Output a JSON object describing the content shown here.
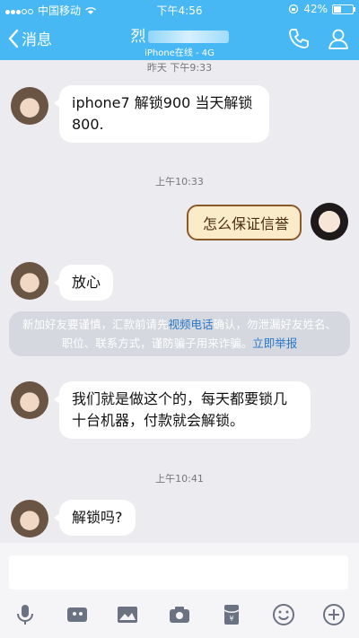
{
  "status_bar": {
    "carrier": "中国移动",
    "time": "下午4:56",
    "battery": "42%"
  },
  "nav": {
    "back_label": "消息",
    "contact_name_visible": "烈",
    "subtitle": "iPhone在线 - 4G"
  },
  "messages": [
    {
      "type": "timestamp",
      "text": "昨天 下午9:33"
    },
    {
      "type": "incoming",
      "text": "iphone7 解锁900 当天解锁800."
    },
    {
      "type": "timestamp",
      "text": "上午10:33"
    },
    {
      "type": "outgoing_sticker",
      "text": "怎么保证信誉"
    },
    {
      "type": "incoming",
      "text": "放心"
    },
    {
      "type": "notice",
      "text_before": "新加好友要谨慎，汇款前请先",
      "link1": "视频电话",
      "text_after": "确认，勿泄漏好友姓名、职位、联系方式，谨防骗子用来诈骗。",
      "link2": "立即举报"
    },
    {
      "type": "incoming",
      "text": "我们就是做这个的，每天都要锁几十台机器，付款就会解锁。"
    },
    {
      "type": "timestamp",
      "text": "上午10:41"
    },
    {
      "type": "incoming",
      "text": "解锁吗?"
    }
  ],
  "toolbar": {
    "icons": [
      "microphone-icon",
      "video-icon",
      "image-icon",
      "camera-icon",
      "red-packet-icon",
      "emoji-icon",
      "plus-icon"
    ]
  },
  "colors": {
    "nav_bg": "#48b8f4",
    "chat_bg": "#ebebf0",
    "link": "#2a79c8"
  }
}
